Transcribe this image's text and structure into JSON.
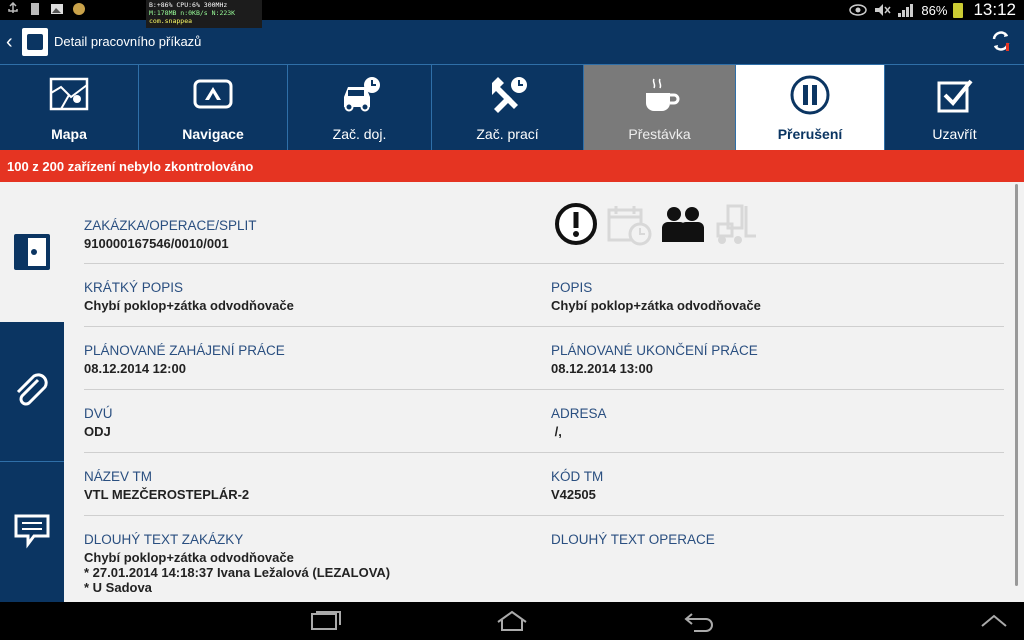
{
  "status_bar": {
    "debug_lines": [
      "B:+86% CPU:6% 300MHz",
      "M:178MB n:0KB/s N:223K",
      "com.snappea"
    ],
    "battery": "86%",
    "time": "13:12",
    "icons": [
      "usb-icon",
      "sdcard-icon",
      "screenshot-icon",
      "app-icon",
      "eye-icon",
      "mute-icon",
      "signal-icon",
      "battery-icon"
    ]
  },
  "action_bar": {
    "title": "Detail pracovního příkazů",
    "back_icon": "chevron-left-icon",
    "refresh_icon": "sync-icon"
  },
  "tabs": [
    {
      "label": "Mapa",
      "icon": "map-icon",
      "state": "normal-bold"
    },
    {
      "label": "Navigace",
      "icon": "navigation-icon",
      "state": "normal-bold"
    },
    {
      "label": "Zač. doj.",
      "icon": "car-clock-icon",
      "state": "normal"
    },
    {
      "label": "Zač. prací",
      "icon": "tools-clock-icon",
      "state": "normal"
    },
    {
      "label": "Přestávka",
      "icon": "coffee-icon",
      "state": "disabled"
    },
    {
      "label": "Přerušení",
      "icon": "pause-icon",
      "state": "active"
    },
    {
      "label": "Uzavřít",
      "icon": "checkbox-icon",
      "state": "normal"
    }
  ],
  "warning": {
    "text": "100 z 200 zařízení nebylo zkontrolováno"
  },
  "side_nav": [
    {
      "icon": "document-icon",
      "state": "active"
    },
    {
      "icon": "paperclip-icon",
      "state": "normal"
    },
    {
      "icon": "comment-icon",
      "state": "normal"
    }
  ],
  "details": {
    "order": {
      "label": "ZAKÁZKA/OPERACE/SPLIT",
      "value": "910000167546/0010/001"
    },
    "status_icons": [
      "exclamation-icon",
      "calendar-clock-icon",
      "people-icon",
      "forklift-icon"
    ],
    "short_desc": {
      "label": "KRÁTKÝ POPIS",
      "value": "Chybí poklop+zátka odvodňovače"
    },
    "desc": {
      "label": "POPIS",
      "value": "Chybí poklop+zátka odvodňovače"
    },
    "planned_start": {
      "label": "PLÁNOVANÉ ZAHÁJENÍ PRÁCE",
      "value": "08.12.2014 12:00"
    },
    "planned_end": {
      "label": "PLÁNOVANÉ UKONČENÍ PRÁCE",
      "value": "08.12.2014 13:00"
    },
    "dvu": {
      "label": "DVÚ",
      "value": "ODJ"
    },
    "address": {
      "label": "ADRESA",
      "value": " /,"
    },
    "tm_name": {
      "label": "NÁZEV TM",
      "value": "VTL MEZČEROSTEPLÁR-2"
    },
    "tm_code": {
      "label": "KÓD TM",
      "value": "V42505"
    },
    "long_order_text": {
      "label": "DLOUHÝ TEXT ZAKÁZKY",
      "value": "Chybí poklop+zátka odvodňovače\n* 27.01.2014 14:18:37 Ivana Ležalová (LEZALOVA)\n* U Sadova"
    },
    "long_op_text": {
      "label": "DLOUHÝ TEXT OPERACE",
      "value": ""
    }
  },
  "nav_bar": [
    "recent-apps-icon",
    "home-icon",
    "back-icon",
    "chevron-up-icon"
  ],
  "colors": {
    "primary": "#0b3562",
    "warning": "#e53422",
    "label": "#2a4f80",
    "disabled_tab": "#7a7a7a"
  }
}
